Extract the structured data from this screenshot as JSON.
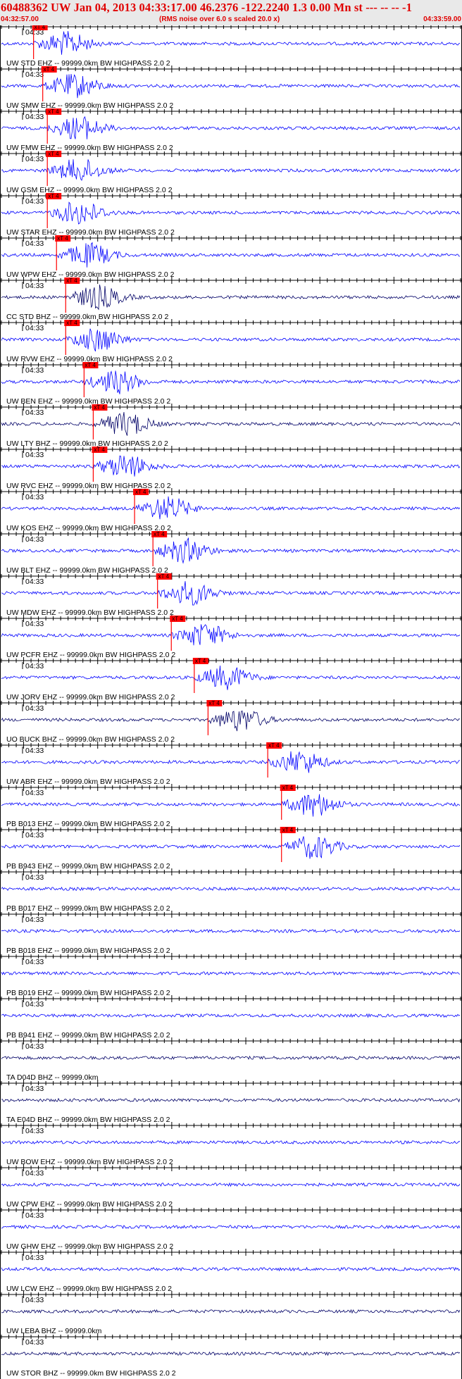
{
  "header": {
    "title": "60488362 UW Jan 04, 2013 04:33:17.00   46.2376 -122.2240  1.3 0.00 Mn st --- -- --  -1",
    "start_time": "04:32:57.00",
    "note": "(RMS noise over 6.0 s scaled 20.0 x)",
    "end_time": "04:33:59.00"
  },
  "minute_label": "04:33",
  "pick_label": "xT 4",
  "colors": {
    "trace_blue": "#0000ff",
    "trace_dark": "#000066",
    "pick_red": "#ff0000",
    "axis": "#000000"
  },
  "channels": [
    {
      "label": "UW STD EHZ -- 99999.0km BW  HIGHPASS  2.0  2",
      "color": "#0000ff",
      "pick": 0.07
    },
    {
      "label": "UW SMW EHZ -- 99999.0km BW  HIGHPASS  2.0  2",
      "color": "#0000ff",
      "pick": 0.09
    },
    {
      "label": "UW FMW EHZ -- 99999.0km BW  HIGHPASS  2.0  2",
      "color": "#0000ff",
      "pick": 0.1
    },
    {
      "label": "UW GSM EHZ -- 99999.0km BW  HIGHPASS  2.0  2",
      "color": "#0000ff",
      "pick": 0.1
    },
    {
      "label": "UW STAR EHZ -- 99999.0km BW  HIGHPASS  2.0  2",
      "color": "#0000ff",
      "pick": 0.1
    },
    {
      "label": "UW WPW EHZ -- 99999.0km BW  HIGHPASS  2.0  2",
      "color": "#0000ff",
      "pick": 0.12
    },
    {
      "label": "CC STD BHZ -- 99999.0km BW  HIGHPASS  2.0  2",
      "color": "#000066",
      "pick": 0.14
    },
    {
      "label": "UW RVW EHZ -- 99999.0km BW  HIGHPASS  2.0  2",
      "color": "#0000ff",
      "pick": 0.14
    },
    {
      "label": "UW BEN EHZ -- 99999.0km BW  HIGHPASS  2.0  2",
      "color": "#0000ff",
      "pick": 0.18
    },
    {
      "label": "UW LTY BHZ -- 99999.0km BW  HIGHPASS  2.0  2",
      "color": "#000066",
      "pick": 0.2
    },
    {
      "label": "UW RVC EHZ -- 99999.0km BW  HIGHPASS  2.0  2",
      "color": "#0000ff",
      "pick": 0.2
    },
    {
      "label": "UW KOS EHZ -- 99999.0km BW  HIGHPASS  2.0  2",
      "color": "#0000ff",
      "pick": 0.29
    },
    {
      "label": "UW BLT EHZ -- 99999.0km BW  HIGHPASS  2.0  2",
      "color": "#0000ff",
      "pick": 0.33
    },
    {
      "label": "UW MDW EHZ -- 99999.0km BW  HIGHPASS  2.0  2",
      "color": "#0000ff",
      "pick": 0.34
    },
    {
      "label": "UW PCFR EHZ -- 99999.0km BW  HIGHPASS  2.0  2",
      "color": "#0000ff",
      "pick": 0.37
    },
    {
      "label": "UW JORV EHZ -- 99999.0km BW  HIGHPASS  2.0  2",
      "color": "#0000ff",
      "pick": 0.42
    },
    {
      "label": "UO BUCK BHZ -- 99999.0km BW  HIGHPASS  2.0  2",
      "color": "#000066",
      "pick": 0.45
    },
    {
      "label": "UW ABR EHZ -- 99999.0km BW  HIGHPASS  2.0  2",
      "color": "#0000ff",
      "pick": 0.58
    },
    {
      "label": "PB B013 EHZ -- 99999.0km BW  HIGHPASS  2.0  2",
      "color": "#0000ff",
      "pick": 0.61
    },
    {
      "label": "PB B943 EHZ -- 99999.0km BW  HIGHPASS  2.0  2",
      "color": "#0000ff",
      "pick": 0.61
    },
    {
      "label": "PB B017 EHZ -- 99999.0km BW  HIGHPASS  2.0  2",
      "color": "#0000ff",
      "pick": null
    },
    {
      "label": "PB B018 EHZ -- 99999.0km BW  HIGHPASS  2.0  2",
      "color": "#0000ff",
      "pick": null
    },
    {
      "label": "PB B019 EHZ -- 99999.0km BW  HIGHPASS  2.0  2",
      "color": "#0000ff",
      "pick": null
    },
    {
      "label": "PB B941 EHZ -- 99999.0km BW  HIGHPASS  2.0  2",
      "color": "#0000ff",
      "pick": null
    },
    {
      "label": "TA D04D BHZ -- 99999.0km",
      "color": "#000066",
      "pick": null
    },
    {
      "label": "TA E04D BHZ -- 99999.0km BW  HIGHPASS  2.0  2",
      "color": "#000066",
      "pick": null
    },
    {
      "label": "UW BOW EHZ -- 99999.0km BW  HIGHPASS  2.0  2",
      "color": "#0000ff",
      "pick": null
    },
    {
      "label": "UW CPW EHZ -- 99999.0km BW  HIGHPASS  2.0  2",
      "color": "#0000ff",
      "pick": null
    },
    {
      "label": "UW GHW EHZ -- 99999.0km BW  HIGHPASS  2.0  2",
      "color": "#0000ff",
      "pick": null
    },
    {
      "label": "UW LCW EHZ -- 99999.0km BW  HIGHPASS  2.0  2",
      "color": "#0000ff",
      "pick": null
    },
    {
      "label": "UW LEBA BHZ -- 99999.0km",
      "color": "#000066",
      "pick": null
    },
    {
      "label": "UW STOR BHZ -- 99999.0km BW  HIGHPASS  2.0  2",
      "color": "#000066",
      "pick": null
    }
  ]
}
